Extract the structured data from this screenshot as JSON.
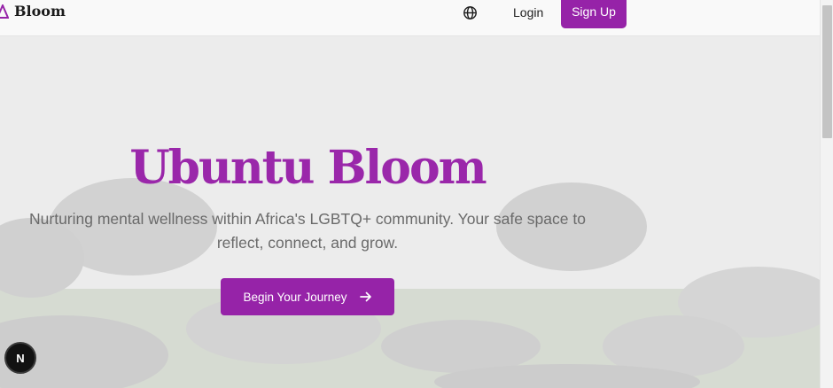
{
  "nav": {
    "brand_name": "Bloom",
    "language_icon": "globe-icon",
    "login_label": "Login",
    "signup_label": "Sign Up"
  },
  "hero": {
    "title": "Ubuntu Bloom",
    "subtitle": "Nurturing mental wellness within Africa's LGBTQ+ community. Your safe space to reflect, connect, and grow.",
    "cta_label": "Begin Your Journey",
    "cta_icon": "arrow-right-icon"
  },
  "dev_badge": {
    "letter": "N"
  },
  "colors": {
    "brand": "#9623a8",
    "title": "#9a27aa",
    "subtitle": "#6a6a6a"
  }
}
